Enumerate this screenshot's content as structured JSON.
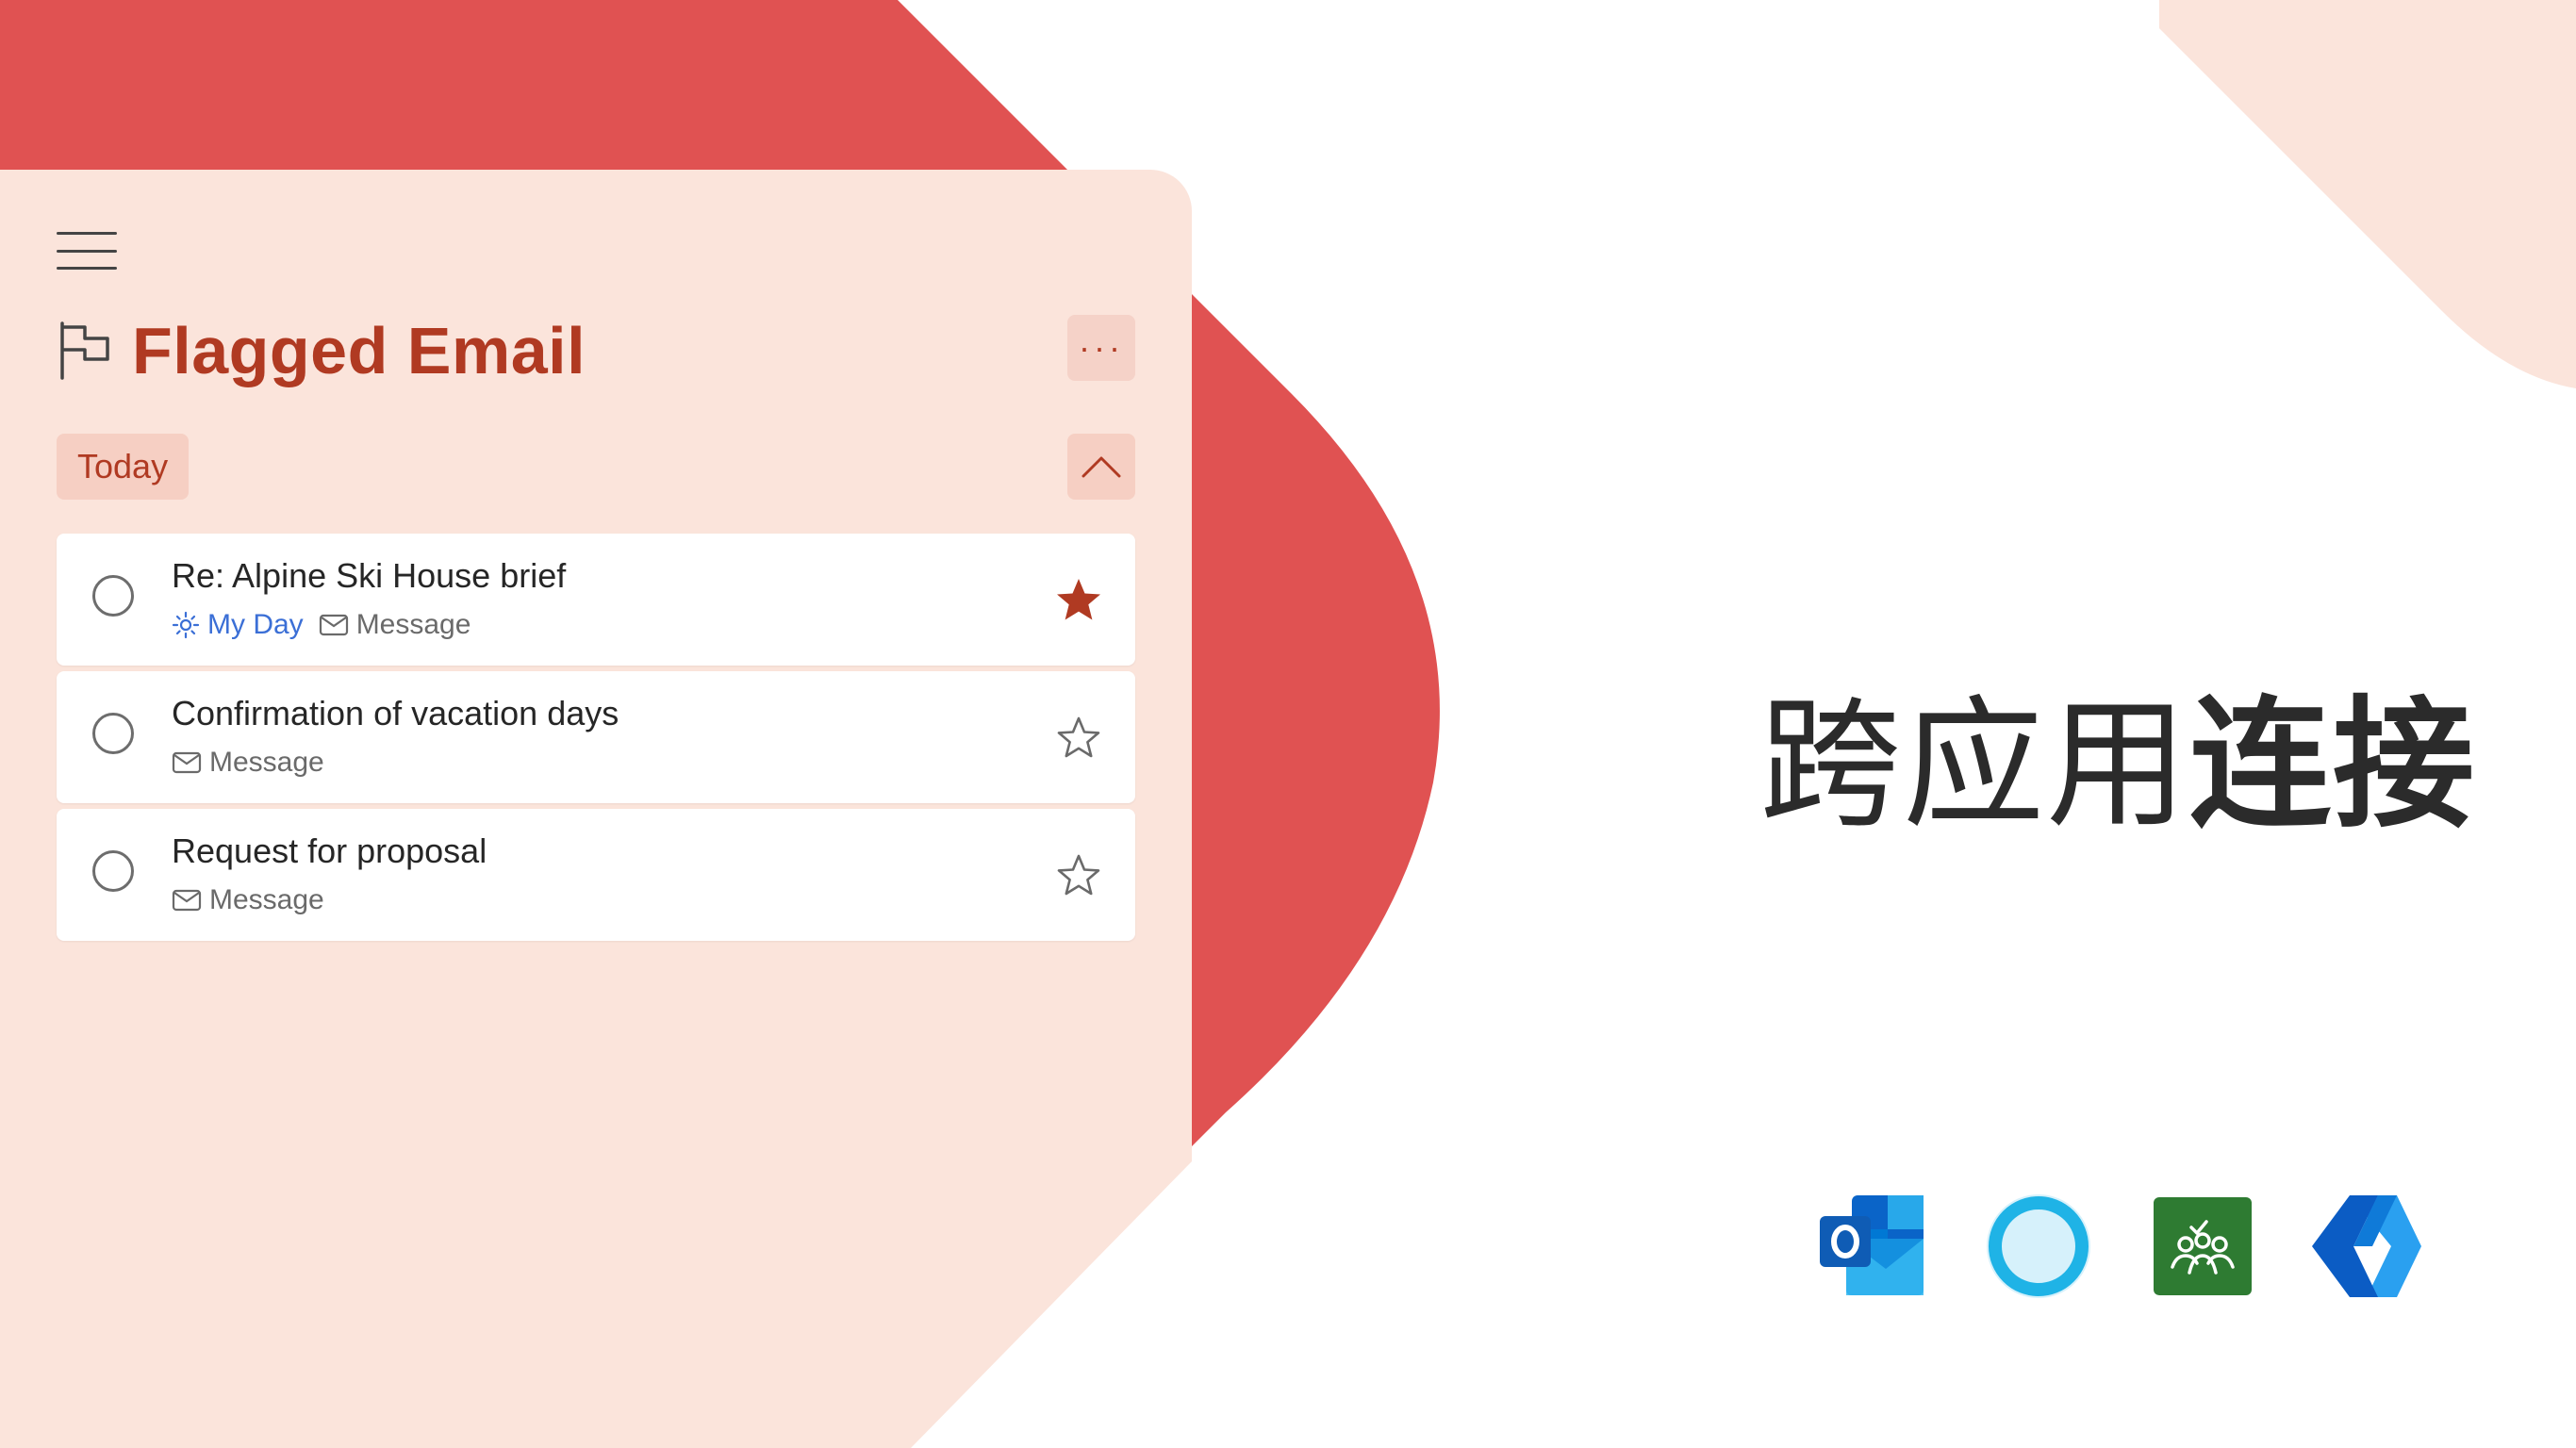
{
  "header": {
    "menu_icon": "hamburger-icon",
    "list_icon": "flag-icon",
    "title": "Flagged Email",
    "more_label": "···"
  },
  "group": {
    "label": "Today",
    "collapse_icon": "chevron-up-icon"
  },
  "tasks": [
    {
      "title": "Re: Alpine Ski House brief",
      "my_day": "My Day",
      "source": "Message",
      "starred": true
    },
    {
      "title": "Confirmation of vacation days",
      "source": "Message",
      "starred": false
    },
    {
      "title": "Request for proposal",
      "source": "Message",
      "starred": false
    }
  ],
  "headline": {
    "regular": "跨应用",
    "bold": "连接"
  },
  "apps": [
    "outlook-icon",
    "cortana-icon",
    "planner-icon",
    "power-automate-icon"
  ],
  "colors": {
    "accent": "#b03a22",
    "shape_red": "#e05252",
    "panel": "#fbe4db",
    "my_day_blue": "#3b6fd6"
  }
}
